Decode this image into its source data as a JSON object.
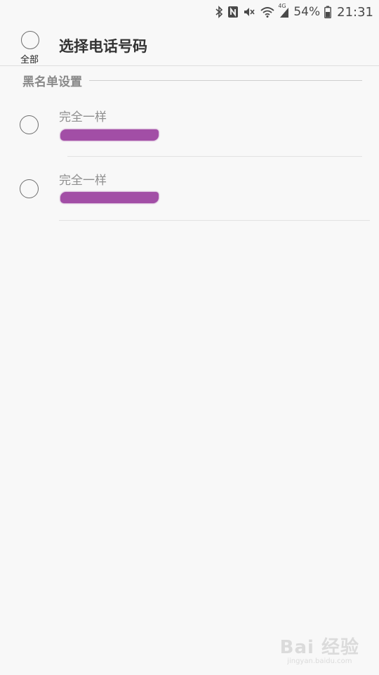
{
  "status_bar": {
    "battery": "54%",
    "time": "21:31",
    "network": "4G",
    "icons": [
      "bluetooth-icon",
      "nfc-icon",
      "mute-icon",
      "wifi-icon",
      "signal-icon",
      "battery-icon"
    ]
  },
  "header": {
    "select_all_label": "全部",
    "title": "选择电话号码"
  },
  "section": {
    "label": "黑名单设置"
  },
  "rows": [
    {
      "match_type": "完全一样"
    },
    {
      "match_type": "完全一样"
    }
  ],
  "colors": {
    "background": "#f8f8f8",
    "redaction": "#a24ea6",
    "radio_border": "#6e6e6e"
  },
  "watermark": {
    "logo": "Bai 经验",
    "sub": "jingyan.baidu.com"
  }
}
